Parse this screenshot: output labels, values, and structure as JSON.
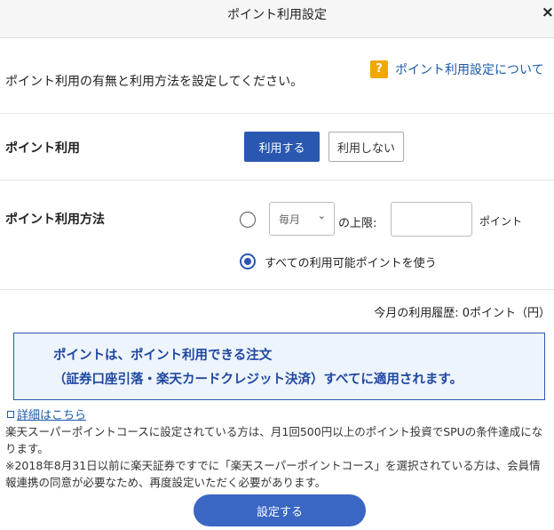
{
  "header": {
    "title": "ポイント利用設定",
    "close": "×"
  },
  "intro": {
    "text": "ポイント利用の有無と利用方法を設定してください。",
    "help_badge": "?",
    "help_link": "ポイント利用設定について"
  },
  "usage": {
    "label": "ポイント利用",
    "use_button": "利用する",
    "no_use_button": "利用しない",
    "selected": "利用する"
  },
  "method": {
    "label": "ポイント利用方法",
    "frequency_value": "毎月",
    "limit_label": "の上限:",
    "limit_value": "",
    "unit": "ポイント",
    "all_points_label": "すべての利用可能ポイントを使う",
    "selected_option": "すべての利用可能ポイントを使う"
  },
  "history": {
    "text": "今月の利用履歴: 0ポイント（円）"
  },
  "notice": {
    "line1": "ポイントは、ポイント利用できる注文",
    "line2": "（証券口座引落・楽天カードクレジット決済）すべてに適用されます。"
  },
  "details": {
    "link": "詳細はこちら",
    "note1": "楽天スーパーポイントコースに設定されている方は、月1回500円以上のポイント投資でSPUの条件達成になります。",
    "note2": "※2018年8月31日以前に楽天証券ですでに「楽天スーパーポイントコース」を選択されている方は、会員情報連携の同意が必要なため、再度設定いただく必要があります。"
  },
  "submit": {
    "label": "設定する"
  },
  "colors": {
    "primary": "#2a57b0",
    "link": "#1a5aa8",
    "help_badge": "#f0a800",
    "notice_bg": "#eef4fc"
  },
  "icons": {
    "help": "question-icon",
    "close": "close-icon",
    "select": "chevron-down-icon",
    "external": "external-link-icon"
  }
}
